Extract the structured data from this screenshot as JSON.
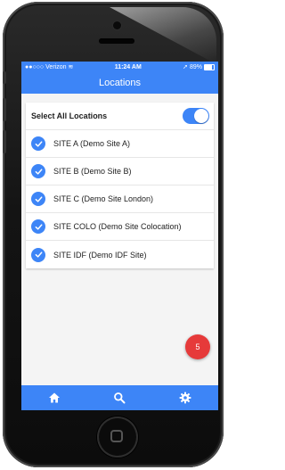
{
  "status_bar": {
    "carrier": "Verizon",
    "time": "11:24 AM",
    "battery": "89%"
  },
  "header": {
    "title": "Locations"
  },
  "select_all": {
    "label": "Select All Locations",
    "enabled": true
  },
  "locations": [
    {
      "label": "SITE A (Demo Site A)",
      "checked": true
    },
    {
      "label": "SITE B (Demo Site B)",
      "checked": true
    },
    {
      "label": "SITE C (Demo Site London)",
      "checked": true
    },
    {
      "label": "SITE COLO (Demo Site Colocation)",
      "checked": true
    },
    {
      "label": "SITE IDF (Demo IDF Site)",
      "checked": true
    }
  ],
  "fab": {
    "count": "5"
  },
  "tab_bar": {
    "items": [
      {
        "icon": "home-icon"
      },
      {
        "icon": "search-icon"
      },
      {
        "icon": "gear-icon"
      }
    ]
  },
  "colors": {
    "accent": "#3d85f7",
    "badge": "#e63a3a"
  }
}
